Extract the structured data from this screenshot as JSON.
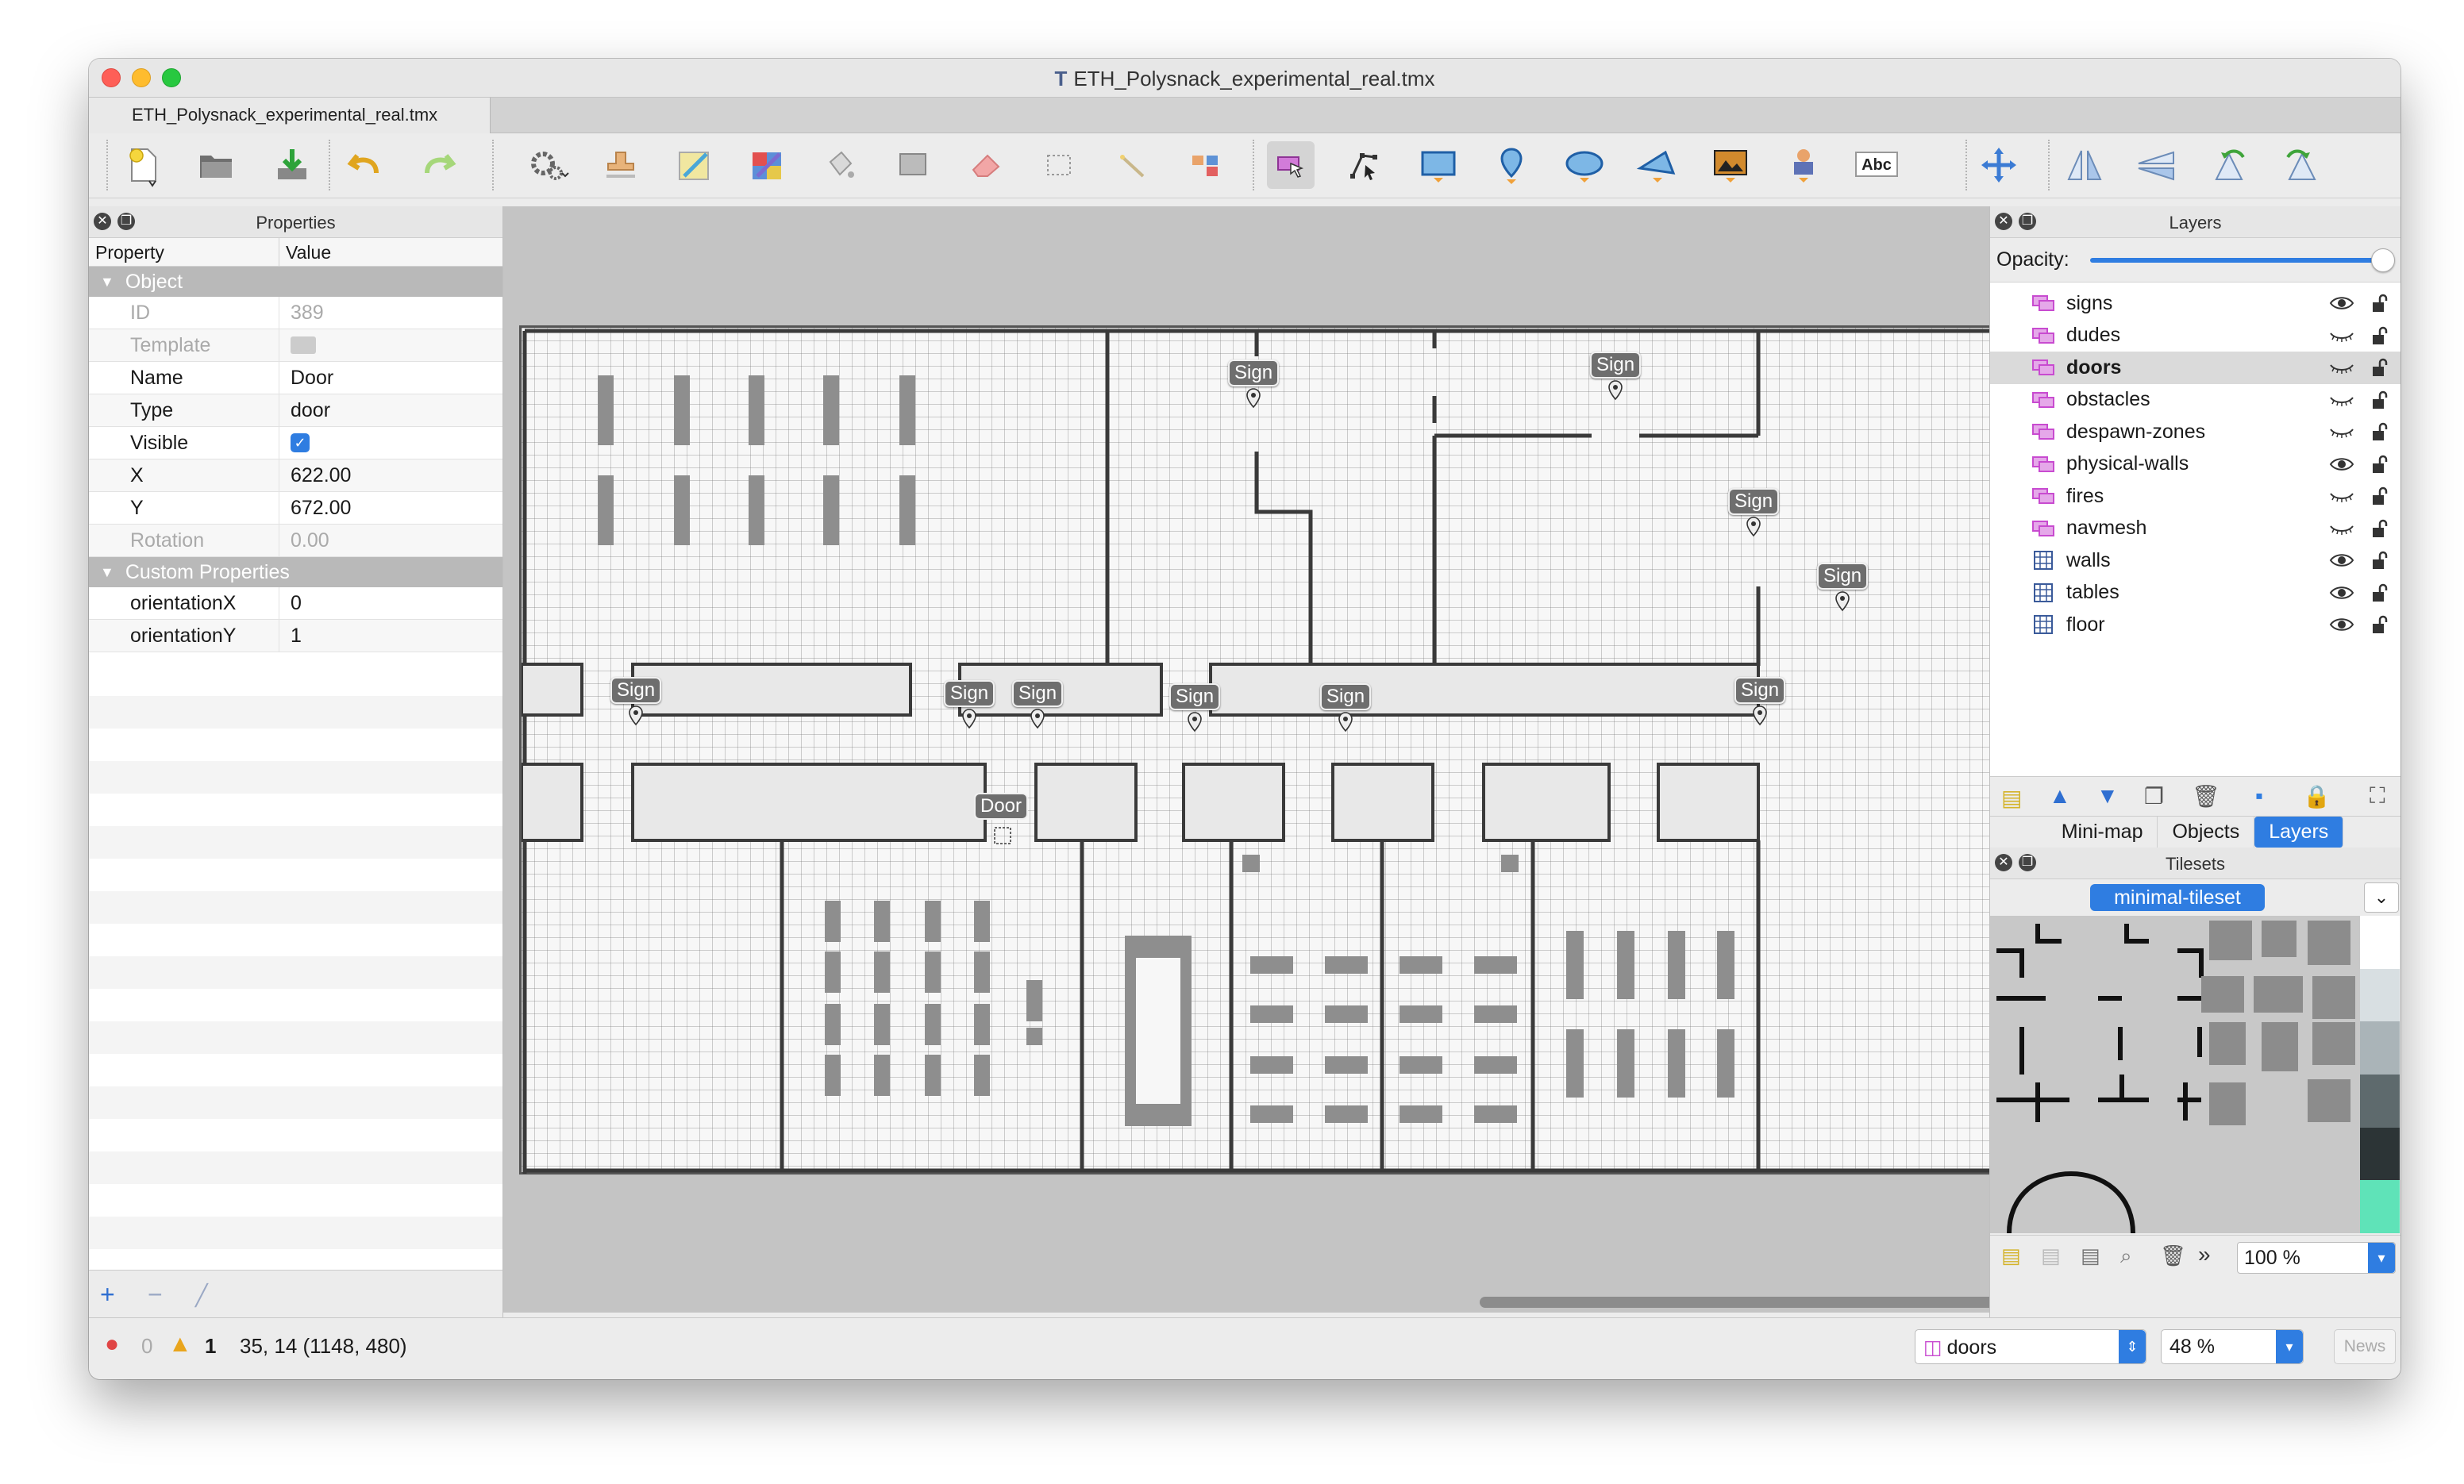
{
  "window": {
    "title": "ETH_Polysnack_experimental_real.tmx",
    "tab_label": "ETH_Polysnack_experimental_real.tmx"
  },
  "toolbar": {
    "buttons": [
      "new-map",
      "open-file",
      "save",
      "undo",
      "redo",
      "world-tool",
      "stamp-brush",
      "terrain-brush",
      "wang-brush",
      "bucket-fill",
      "shape-fill",
      "eraser",
      "rectangular-select",
      "magic-wand",
      "select-same-tile",
      "select-objects",
      "edit-polygons",
      "insert-rectangle",
      "insert-point",
      "insert-ellipse",
      "insert-polygon",
      "insert-tile",
      "insert-template",
      "insert-text",
      "offset-layer",
      "flip-horizontal",
      "flip-vertical",
      "rotate-left",
      "rotate-right"
    ],
    "text_tool_label": "Abc"
  },
  "properties": {
    "title": "Properties",
    "col_property": "Property",
    "col_value": "Value",
    "section_object": "Object",
    "section_custom": "Custom Properties",
    "rows": [
      {
        "key": "ID",
        "value": "389",
        "disabled": true
      },
      {
        "key": "Template",
        "value": "",
        "disabled": true
      },
      {
        "key": "Name",
        "value": "Door"
      },
      {
        "key": "Type",
        "value": "door"
      },
      {
        "key": "Visible",
        "value": ""
      },
      {
        "key": "X",
        "value": "622.00"
      },
      {
        "key": "Y",
        "value": "672.00"
      },
      {
        "key": "Rotation",
        "value": "0.00",
        "disabled": true
      }
    ],
    "custom_rows": [
      {
        "key": "orientationX",
        "value": "0"
      },
      {
        "key": "orientationY",
        "value": "1"
      }
    ]
  },
  "map": {
    "sign_label": "Sign",
    "door_label": "Door"
  },
  "layers": {
    "title": "Layers",
    "opacity_label": "Opacity:",
    "items": [
      {
        "name": "signs",
        "kind": "object",
        "visible": true
      },
      {
        "name": "dudes",
        "kind": "object",
        "visible": false
      },
      {
        "name": "doors",
        "kind": "object",
        "visible": false,
        "selected": true
      },
      {
        "name": "obstacles",
        "kind": "object",
        "visible": false
      },
      {
        "name": "despawn-zones",
        "kind": "object",
        "visible": false
      },
      {
        "name": "physical-walls",
        "kind": "object",
        "visible": true
      },
      {
        "name": "fires",
        "kind": "object",
        "visible": false
      },
      {
        "name": "navmesh",
        "kind": "object",
        "visible": false
      },
      {
        "name": "walls",
        "kind": "tile",
        "visible": true
      },
      {
        "name": "tables",
        "kind": "tile",
        "visible": true
      },
      {
        "name": "floor",
        "kind": "tile",
        "visible": true
      }
    ],
    "tabs": [
      "Mini-map",
      "Objects",
      "Layers"
    ]
  },
  "tilesets": {
    "title": "Tilesets",
    "active_tab": "minimal-tileset",
    "zoom": "100 %",
    "swatch_colors": [
      "#ffffff",
      "#d8dfe2",
      "#aab4b8",
      "#5e6a6d",
      "#2c3436",
      "#5fe3b8"
    ]
  },
  "status": {
    "errors": "0",
    "warnings": "1",
    "coords": "35, 14 (1148, 480)",
    "layer_combo": "doors",
    "zoom": "48 %",
    "news": "News"
  },
  "colors": {
    "accent": "#2f7de1",
    "layer_icon_purple": "#c84bd0"
  }
}
